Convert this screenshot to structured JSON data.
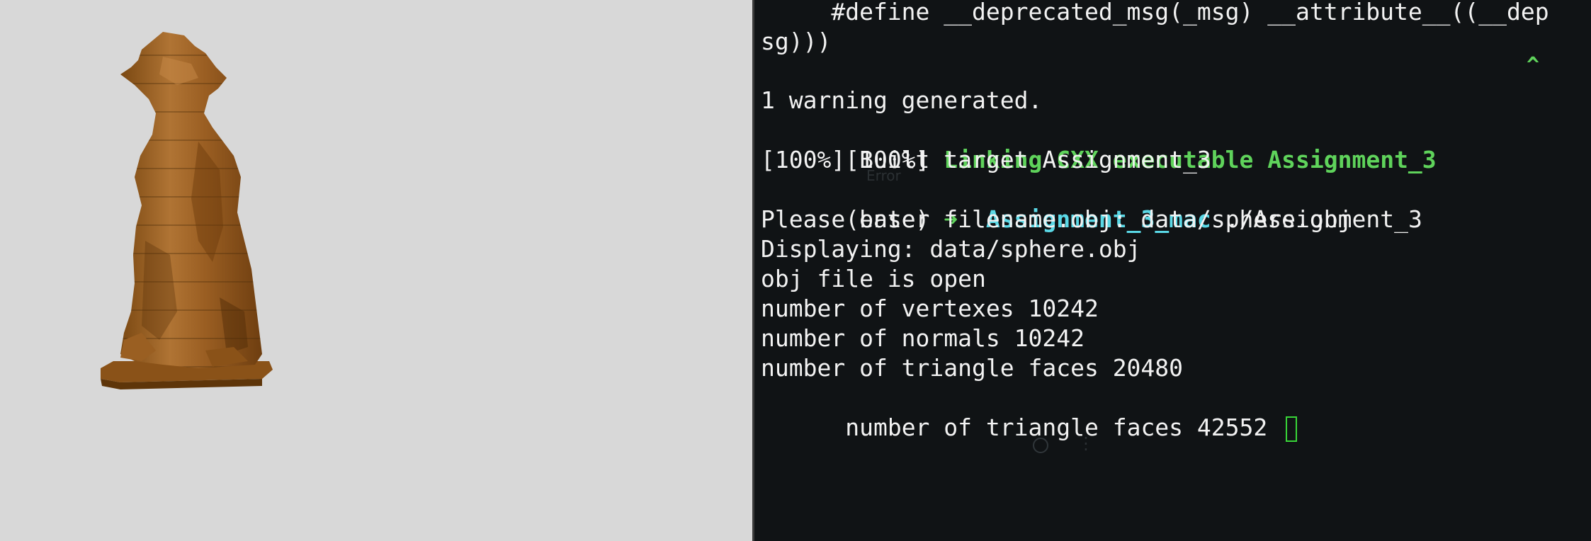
{
  "terminal": {
    "lines": [
      {
        "id": "l0",
        "text": "     #define __deprecated_msg(_msg) __attribute__((__dep"
      },
      {
        "id": "l1",
        "text": "sg)))"
      },
      {
        "id": "l2",
        "text": "1 warning generated."
      },
      {
        "id": "l3_prefix",
        "text": "[100%] "
      },
      {
        "id": "l3_text",
        "text": "Linking CXX executable Assignment_3"
      },
      {
        "id": "l4",
        "text": "[100%] Built target Assignment_3"
      },
      {
        "id": "l5_prefix",
        "text": "(base) "
      },
      {
        "id": "l5_arrow",
        "text": "➜  "
      },
      {
        "id": "l5_dir",
        "text": "Assignment_3_mac"
      },
      {
        "id": "l5_cmd",
        "text": " ./Assignment_3"
      },
      {
        "id": "l6",
        "text": "Please enter filename.obj: data/sphere.obj"
      },
      {
        "id": "l7",
        "text": "Displaying: data/sphere.obj"
      },
      {
        "id": "l8",
        "text": "obj file is open"
      },
      {
        "id": "l9",
        "text": "number of vertexes 10242"
      },
      {
        "id": "l10",
        "text": "number of normals 10242"
      },
      {
        "id": "l11",
        "text": "number of triangle faces 20480"
      },
      {
        "id": "l12",
        "text": "number of triangle faces 42552 "
      }
    ],
    "caret_marker": "^",
    "ghost_overlay_text": "Error",
    "colors": {
      "background": "#101315",
      "text": "#f2f2f2",
      "green": "#5fd35b",
      "cyan": "#5ad8e6"
    }
  },
  "viewport": {
    "background": "#d8d8d8",
    "model_color": "#a5692b",
    "model_description_icon": "3d-model-render"
  }
}
